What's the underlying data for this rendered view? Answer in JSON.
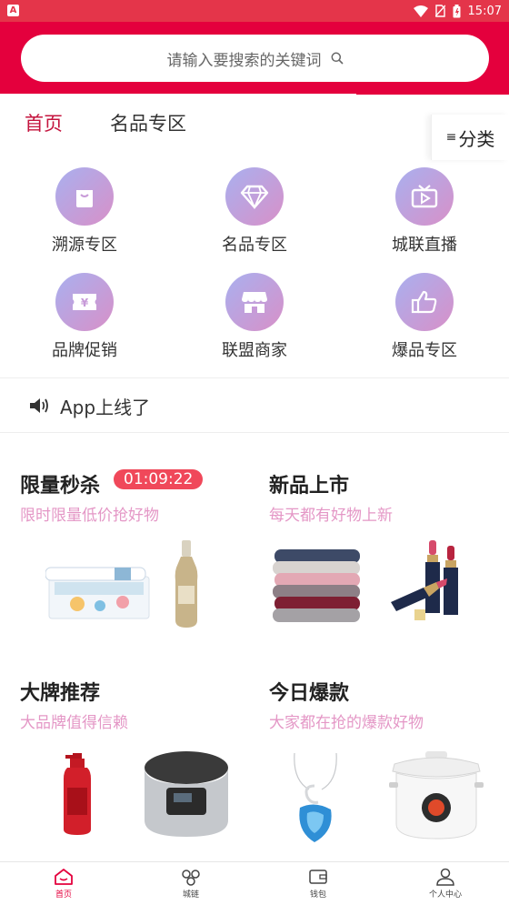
{
  "status_bar": {
    "time": "15:07",
    "app_badge": "A"
  },
  "search": {
    "placeholder": "请输入要搜索的关键词",
    "icon": "search-icon"
  },
  "tabs": [
    {
      "label": "首页",
      "active": true
    },
    {
      "label": "名品专区",
      "active": false
    }
  ],
  "category_button": {
    "label": "分类",
    "icon": "menu-lines-icon"
  },
  "grid": [
    {
      "label": "溯源专区",
      "icon": "bag-icon"
    },
    {
      "label": "名品专区",
      "icon": "diamond-icon"
    },
    {
      "label": "城联直播",
      "icon": "tv-play-icon"
    },
    {
      "label": "品牌促销",
      "icon": "yen-ticket-icon"
    },
    {
      "label": "联盟商家",
      "icon": "store-icon"
    },
    {
      "label": "爆品专区",
      "icon": "thumbs-up-icon"
    }
  ],
  "notice": {
    "text": "App上线了",
    "icon": "speaker-icon"
  },
  "sections": [
    {
      "title": "限量秒杀",
      "subtitle": "限时限量低价抢好物",
      "timer": "01:09:22"
    },
    {
      "title": "新品上市",
      "subtitle": "每天都有好物上新"
    },
    {
      "title": "大牌推荐",
      "subtitle": "大品牌值得信赖"
    },
    {
      "title": "今日爆款",
      "subtitle": "大家都在抢的爆款好物"
    }
  ],
  "bottom_nav": [
    {
      "label": "首页",
      "icon": "home-icon",
      "active": true
    },
    {
      "label": "城链",
      "icon": "link-icon",
      "active": false
    },
    {
      "label": "钱包",
      "icon": "wallet-icon",
      "active": false
    },
    {
      "label": "个人中心",
      "icon": "user-icon",
      "active": false
    }
  ],
  "colors": {
    "brand": "#e4003d",
    "accent_text": "#c4143e",
    "subtitle": "#e497c6",
    "timer": "#f0485a"
  }
}
